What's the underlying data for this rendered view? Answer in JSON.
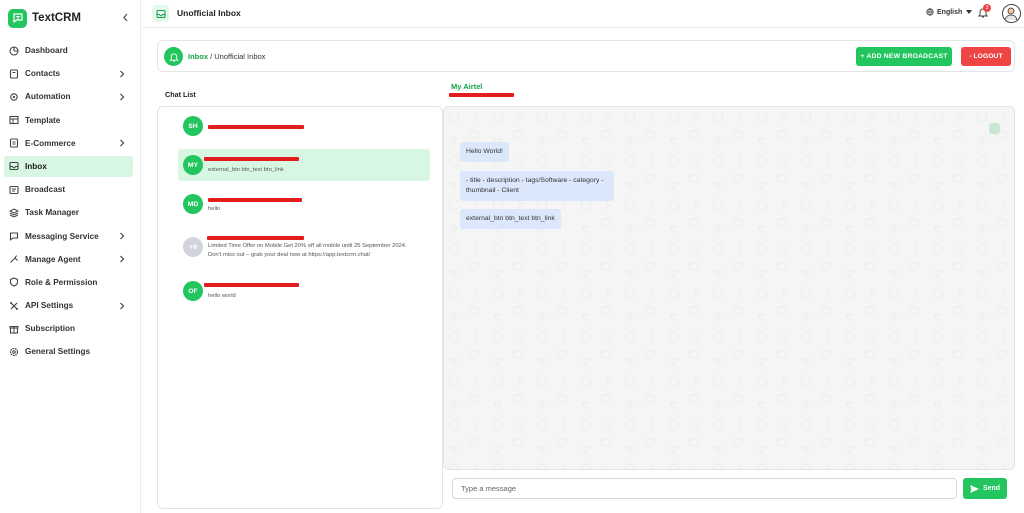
{
  "app": {
    "name": "TextCRM"
  },
  "sidebar": {
    "items": [
      {
        "label": "Dashboard",
        "icon": "dashboard-icon",
        "chevron": false,
        "active": false
      },
      {
        "label": "Contacts",
        "icon": "contacts-icon",
        "chevron": true,
        "active": false
      },
      {
        "label": "Automation",
        "icon": "automation-icon",
        "chevron": true,
        "active": false
      },
      {
        "label": "Template",
        "icon": "template-icon",
        "chevron": false,
        "active": false
      },
      {
        "label": "E-Commerce",
        "icon": "ecommerce-icon",
        "chevron": true,
        "active": false
      },
      {
        "label": "Inbox",
        "icon": "inbox-icon",
        "chevron": false,
        "active": true
      },
      {
        "label": "Broadcast",
        "icon": "broadcast-icon",
        "chevron": false,
        "active": false
      },
      {
        "label": "Task Manager",
        "icon": "task-manager-icon",
        "chevron": false,
        "active": false
      },
      {
        "label": "Messaging Service",
        "icon": "messaging-service-icon",
        "chevron": true,
        "active": false
      },
      {
        "label": "Manage Agent",
        "icon": "manage-agent-icon",
        "chevron": true,
        "active": false
      },
      {
        "label": "Role & Permission",
        "icon": "role-permission-icon",
        "chevron": false,
        "active": false
      },
      {
        "label": "API Settings",
        "icon": "api-settings-icon",
        "chevron": true,
        "active": false
      },
      {
        "label": "Subscription",
        "icon": "subscription-icon",
        "chevron": false,
        "active": false
      },
      {
        "label": "General Settings",
        "icon": "general-settings-icon",
        "chevron": false,
        "active": false
      }
    ]
  },
  "topbar": {
    "title": "Unofficial Inbox",
    "language": "English",
    "notification_count": "3"
  },
  "header": {
    "breadcrumb_link": "Inbox",
    "breadcrumb_separator": " / ",
    "breadcrumb_current": "Unofficial Inbox",
    "add_broadcast_label": "+ ADD NEW BROADCAST",
    "logout_label": "- LOGOUT"
  },
  "chat_list": {
    "title": "Chat List",
    "items": [
      {
        "initials": "SH",
        "name": "",
        "preview": "",
        "selected": false,
        "grey": false
      },
      {
        "initials": "MY",
        "name": "",
        "preview": "external_btn btn_text btn_link",
        "selected": true,
        "grey": false
      },
      {
        "initials": "MD",
        "name": "",
        "preview": "hello",
        "selected": false,
        "grey": false
      },
      {
        "initials": "+9",
        "name": "",
        "preview": "Limited Time Offer on Mobile  Get 20% off all mobile until 25 September 2024.  Don't miss out – grab your deal now at https://app.textcrm.chat/",
        "selected": false,
        "grey": true
      },
      {
        "initials": "OF",
        "name": "",
        "preview": "hello world",
        "selected": false,
        "grey": false
      }
    ]
  },
  "conversation": {
    "contact_name": "My Airtel",
    "messages": [
      {
        "text": "Hello World!"
      },
      {
        "text": "- title - description - tags/Software - category - thumbnail - Client"
      },
      {
        "text": "external_btn btn_text btn_link"
      }
    ]
  },
  "composer": {
    "placeholder": "Type a message",
    "send_label": "Send"
  },
  "colors": {
    "accent": "#22c55e",
    "accent_light": "#d7f7e3",
    "danger": "#ef4444",
    "bubble": "#dbe8fb"
  }
}
